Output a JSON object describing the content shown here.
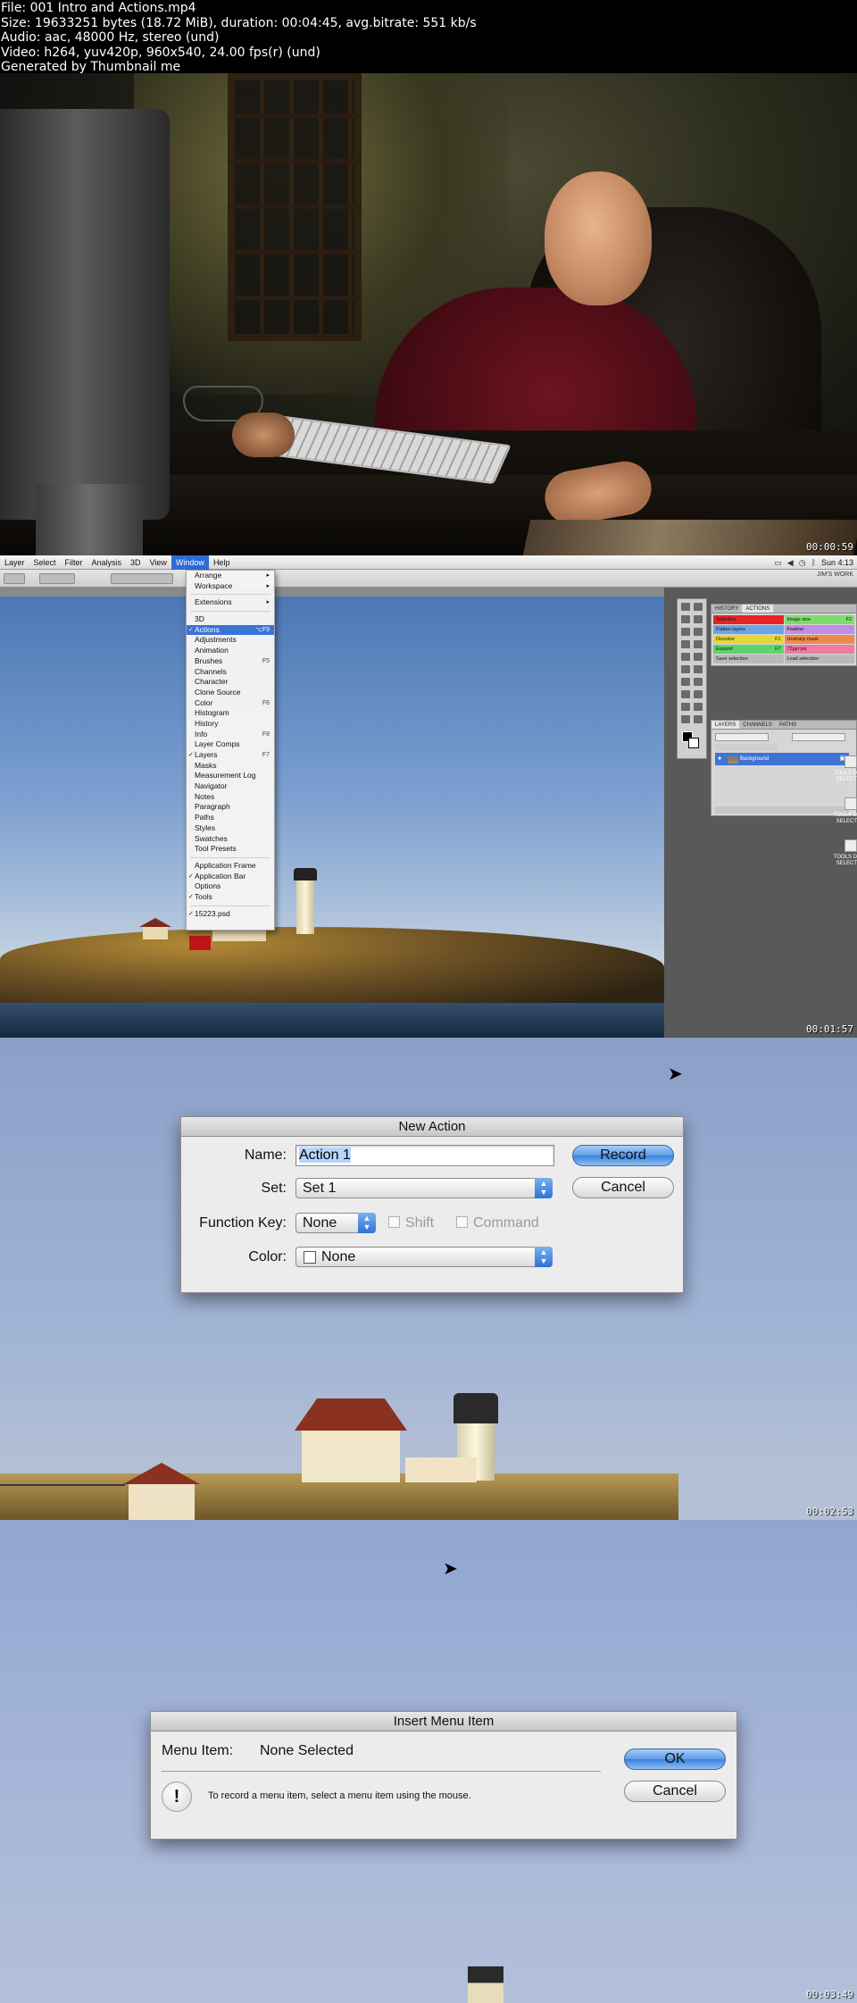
{
  "header": {
    "line1": "File: 001 Intro and Actions.mp4",
    "line2": "Size: 19633251 bytes (18.72 MiB), duration: 00:04:45, avg.bitrate: 551 kb/s",
    "line3": "Audio: aac, 48000 Hz, stereo (und)",
    "line4": "Video: h264, yuv420p, 960x540, 24.00 fps(r) (und)",
    "line5": "Generated by Thumbnail me"
  },
  "frames": {
    "f1_time": "00:00:59",
    "f2_time": "00:01:57",
    "f3_time": "00:02:53",
    "f4_time": "00:03:49"
  },
  "photoshop": {
    "menubar": [
      "Layer",
      "Select",
      "Filter",
      "Analysis",
      "3D",
      "Window",
      "Help"
    ],
    "clock": "Sun 4:13",
    "workspace": "JIM'S WORK",
    "window_menu": [
      {
        "label": "Arrange",
        "arrow": "▸"
      },
      {
        "label": "Workspace",
        "arrow": "▸"
      },
      {
        "sep": true
      },
      {
        "label": "Extensions",
        "arrow": "▸"
      },
      {
        "sep": true
      },
      {
        "label": "3D"
      },
      {
        "label": "Actions",
        "check": "✓",
        "shortcut": "⌥F9",
        "selected": true
      },
      {
        "label": "Adjustments"
      },
      {
        "label": "Animation"
      },
      {
        "label": "Brushes",
        "shortcut": "F5"
      },
      {
        "label": "Channels"
      },
      {
        "label": "Character"
      },
      {
        "label": "Clone Source"
      },
      {
        "label": "Color",
        "shortcut": "F6"
      },
      {
        "label": "Histogram"
      },
      {
        "label": "History"
      },
      {
        "label": "Info",
        "shortcut": "F8"
      },
      {
        "label": "Layer Comps"
      },
      {
        "label": "Layers",
        "check": "✓",
        "shortcut": "F7"
      },
      {
        "label": "Masks"
      },
      {
        "label": "Measurement Log"
      },
      {
        "label": "Navigator"
      },
      {
        "label": "Notes"
      },
      {
        "label": "Paragraph"
      },
      {
        "label": "Paths"
      },
      {
        "label": "Styles"
      },
      {
        "label": "Swatches"
      },
      {
        "label": "Tool Presets"
      },
      {
        "sep": true
      },
      {
        "label": "Application Frame"
      },
      {
        "label": "Application Bar",
        "check": "✓"
      },
      {
        "label": "Options"
      },
      {
        "label": "Tools",
        "check": "✓"
      },
      {
        "sep": true
      },
      {
        "label": "15223.psd",
        "check": "✓"
      }
    ],
    "panel_tabs": [
      "HISTORY",
      "ACTIONS"
    ],
    "actions": [
      {
        "name": "Selection",
        "key": "",
        "color": "#e8232a"
      },
      {
        "name": "Image size",
        "key": "F2",
        "color": "#7ddc6b"
      },
      {
        "name": "Flatten layers",
        "key": "",
        "color": "#6aa4e8"
      },
      {
        "name": "Feather",
        "key": "",
        "color": "#c28de6"
      },
      {
        "name": "Dissolve",
        "key": "F1",
        "color": "#e6d83a"
      },
      {
        "name": "Unsharp mask",
        "key": "",
        "color": "#f08a4b"
      },
      {
        "name": "Expand",
        "key": "F7",
        "color": "#5fd46a"
      },
      {
        "name": "72ppi pix",
        "key": "",
        "color": "#f07aa0"
      },
      {
        "name": "Save selection",
        "key": "",
        "color": "#b9b9b9"
      },
      {
        "name": "Load selection",
        "key": "",
        "color": "#b9b9b9"
      }
    ],
    "layers_tabs": [
      "LAYERS",
      "CHANNELS",
      "PATHS"
    ],
    "layer_name": "Background",
    "desktop_icons": [
      "TOOLS D SELECT",
      "TOOLS D SELECT",
      "TOOLS D SELECT"
    ]
  },
  "new_action": {
    "title": "New Action",
    "name_label": "Name:",
    "name_value": "Action 1",
    "set_label": "Set:",
    "set_value": "Set 1",
    "fkey_label": "Function Key:",
    "fkey_value": "None",
    "shift_label": "Shift",
    "command_label": "Command",
    "color_label": "Color:",
    "color_value": "None",
    "record_button": "Record",
    "cancel_button": "Cancel"
  },
  "insert_menu": {
    "title": "Insert Menu Item",
    "menu_item_label": "Menu Item:",
    "menu_item_value": "None Selected",
    "info_text": "To record a menu item, select a menu item using the mouse.",
    "ok_button": "OK",
    "cancel_button": "Cancel"
  }
}
